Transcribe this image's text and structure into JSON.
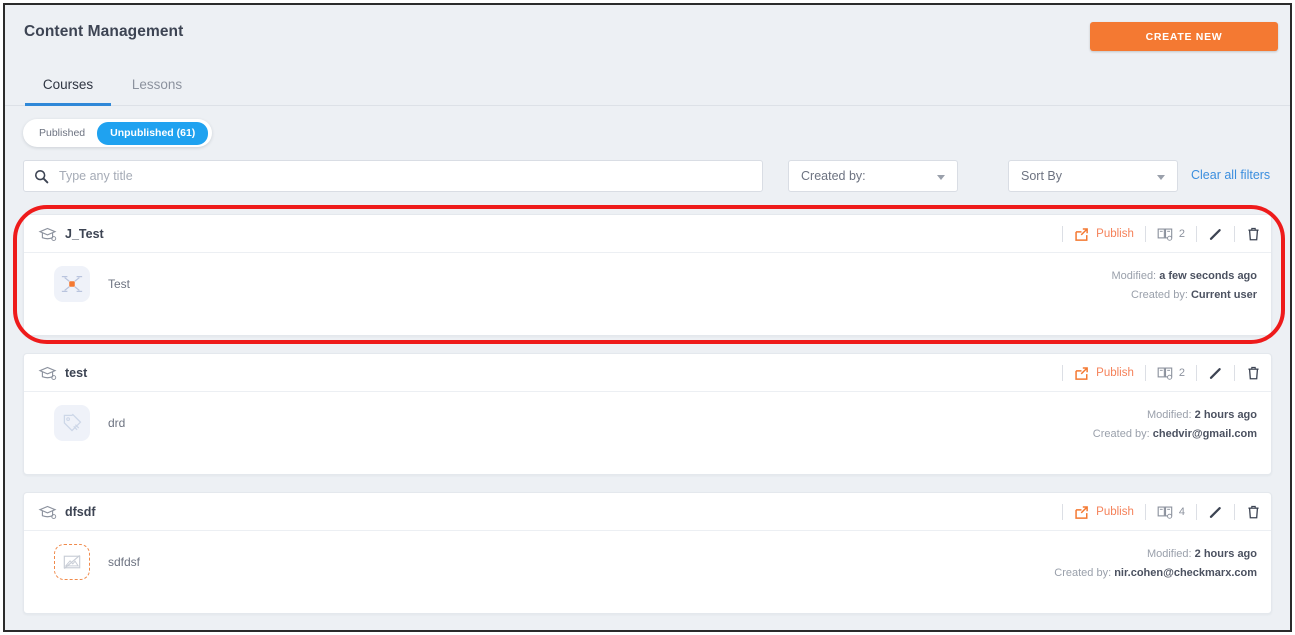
{
  "header": {
    "title": "Content Management",
    "create_new_label": "CREATE NEW"
  },
  "tabs": [
    {
      "label": "Courses",
      "active": true
    },
    {
      "label": "Lessons",
      "active": false
    }
  ],
  "status_toggle": {
    "options": [
      {
        "label": "Published",
        "selected": false
      },
      {
        "label": "Unpublished (61)",
        "selected": true
      }
    ],
    "selected_color": "#1fa2f0"
  },
  "filters": {
    "search": {
      "value": "",
      "placeholder": "Type any title",
      "icon": "search-icon"
    },
    "created_by": {
      "label": "Created by:"
    },
    "sort_by": {
      "label": "Sort By"
    },
    "clear_all": "Clear all filters",
    "link_color": "#3b8ede"
  },
  "action_labels": {
    "publish": "Publish",
    "publish_color": "#f5825a"
  },
  "meta_labels": {
    "modified": "Modified:",
    "created_by": "Created by:"
  },
  "courses": [
    {
      "name": "J_Test",
      "lesson_count": "2",
      "highlighted": true,
      "lesson": {
        "title": "Test",
        "thumb_type": "drone-icon"
      },
      "modified": "a few seconds ago",
      "created_by": "Current user"
    },
    {
      "name": "test",
      "lesson_count": "2",
      "highlighted": false,
      "lesson": {
        "title": "drd",
        "thumb_type": "tag-icon"
      },
      "modified": "2 hours ago",
      "created_by": "chedvir@gmail.com"
    },
    {
      "name": "dfsdf",
      "lesson_count": "4",
      "highlighted": false,
      "lesson": {
        "title": "sdfdsf",
        "thumb_type": "broken-image-icon"
      },
      "modified": "2 hours ago",
      "created_by": "nir.cohen@checkmarx.com"
    }
  ],
  "theme": {
    "accent_orange": "#f47932",
    "page_bg": "#edf0f4",
    "annotation_red": "#ee1b1b"
  }
}
